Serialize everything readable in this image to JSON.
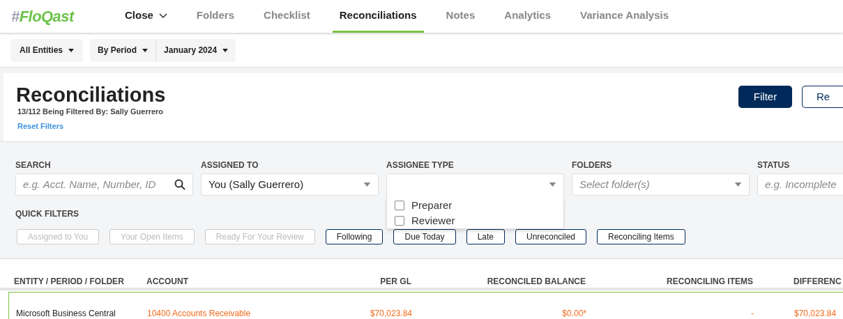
{
  "logo": {
    "mark": "#",
    "name": "FloQast"
  },
  "nav": [
    {
      "label": "Close",
      "kind": "menu",
      "selected": false
    },
    {
      "label": "Folders",
      "kind": "tab",
      "selected": false
    },
    {
      "label": "Checklist",
      "kind": "tab",
      "selected": false
    },
    {
      "label": "Reconciliations",
      "kind": "tab",
      "selected": true
    },
    {
      "label": "Notes",
      "kind": "tab",
      "selected": false
    },
    {
      "label": "Analytics",
      "kind": "tab",
      "selected": false
    },
    {
      "label": "Variance Analysis",
      "kind": "tab",
      "selected": false
    }
  ],
  "toolbar": {
    "entities": "All Entities",
    "period_mode": "By Period",
    "period": "January 2024"
  },
  "header": {
    "title": "Reconciliations",
    "subtitle": "13/112 Being Filtered By: Sally Guerrero",
    "reset_link": "Reset Filters",
    "buttons": [
      {
        "label": "Filter",
        "kind": "primary"
      },
      {
        "label": "Re",
        "kind": "outline"
      }
    ]
  },
  "filters": [
    {
      "label": "SEARCH",
      "kind": "search",
      "placeholder": "e.g. Acct. Name, Number, ID"
    },
    {
      "label": "ASSIGNED TO",
      "kind": "select",
      "value": "You (Sally Guerrero)"
    },
    {
      "label": "ASSIGNEE TYPE",
      "kind": "select",
      "expanded": true,
      "options": [
        {
          "label": "Preparer",
          "checked": false
        },
        {
          "label": "Reviewer",
          "checked": false
        }
      ]
    },
    {
      "label": "FOLDERS",
      "kind": "select",
      "placeholder": "Select folder(s)"
    },
    {
      "label": "STATUS",
      "kind": "text",
      "placeholder": "e.g. Incomplete"
    }
  ],
  "quick_filters": {
    "label": "QUICK FILTERS",
    "items": [
      {
        "label": "Assigned to You",
        "disabled": true
      },
      {
        "label": "Your Open Items",
        "disabled": true
      },
      {
        "label": "Ready For Your Review",
        "disabled": true
      },
      {
        "label": "Following",
        "disabled": false
      },
      {
        "label": "Due Today",
        "disabled": false
      },
      {
        "label": "Late",
        "disabled": false
      },
      {
        "label": "Unreconciled",
        "disabled": false
      },
      {
        "label": "Reconciling Items",
        "disabled": false
      }
    ]
  },
  "table": {
    "columns": [
      "ENTITY / PERIOD / FOLDER",
      "ACCOUNT",
      "PER GL",
      "RECONCILED BALANCE",
      "RECONCILING ITEMS",
      "DIFFERENC"
    ],
    "rows": [
      {
        "cells": [
          "Microsoft Business Central",
          "10400 Accounts Receivable",
          "$70,023.84",
          "$0.00*",
          "-",
          "$70,023.84"
        ]
      }
    ]
  }
}
